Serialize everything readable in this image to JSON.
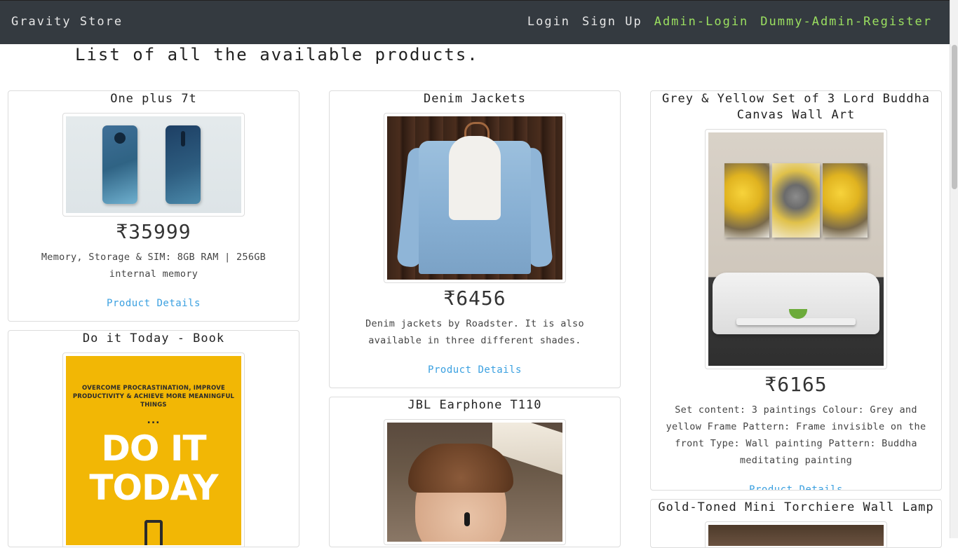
{
  "navbar": {
    "brand": "Gravity Store",
    "links": {
      "login": "Login",
      "signup": "Sign Up",
      "admin_login": "Admin-Login",
      "dummy_admin_register": "Dummy-Admin-Register"
    }
  },
  "page": {
    "heading": "List of all the available products."
  },
  "products": [
    {
      "title": "One plus 7t",
      "price": "₹35999",
      "description": "Memory, Storage & SIM: 8GB RAM | 256GB internal memory",
      "details_label": "Product Details"
    },
    {
      "title": "Denim Jackets",
      "price": "₹6456",
      "description": "Denim jackets by Roadster. It is also available in three different shades.",
      "details_label": "Product Details"
    },
    {
      "title": "Grey & Yellow Set of 3 Lord Buddha Canvas Wall Art",
      "price": "₹6165",
      "description": "Set content: 3 paintings Colour: Grey and yellow Frame Pattern: Frame invisible on the front Type: Wall painting Pattern: Buddha meditating painting",
      "details_label": "Product Details"
    },
    {
      "title": "Do it Today - Book",
      "book_cover": {
        "subtitle": "OVERCOME PROCRASTINATION, IMPROVE PRODUCTIVITY & ACHIEVE MORE MEANINGFUL THINGS",
        "dots": "...",
        "title": "DO IT TODAY"
      }
    },
    {
      "title": "JBL Earphone T110"
    },
    {
      "title": "Gold-Toned Mini Torchiere Wall Lamp"
    }
  ],
  "colors": {
    "navbar_bg": "#343a40",
    "admin_link": "#9be060",
    "details_link": "#3aa0e0",
    "book_cover": "#f2b705"
  }
}
